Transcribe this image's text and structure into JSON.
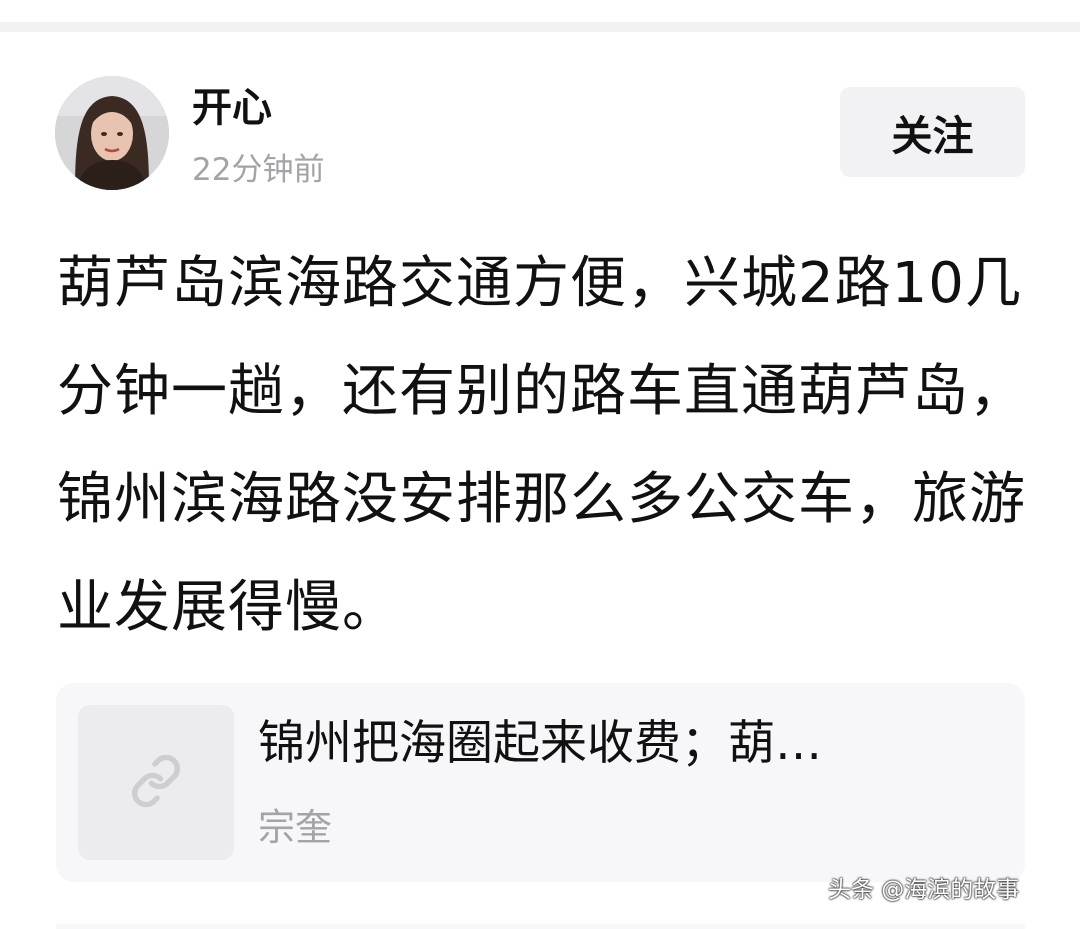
{
  "post": {
    "author": {
      "name": "开心",
      "time": "22分钟前"
    },
    "follow_label": "关注",
    "text": "葫芦岛滨海路交通方便，兴城2路10几分钟一趟，还有别的路车直通葫芦岛，锦州滨海路没安排那么多公交车，旅游业发展得慢。"
  },
  "link_card": {
    "title": "锦州把海圈起来收费；葫…",
    "source": "宗奎",
    "icon": "link-icon"
  },
  "watermark": "头条 @海滨的故事",
  "colors": {
    "text": "#111111",
    "secondary_text": "#a3a3a8",
    "button_bg": "#f2f2f4",
    "card_bg": "#f7f7f9"
  }
}
